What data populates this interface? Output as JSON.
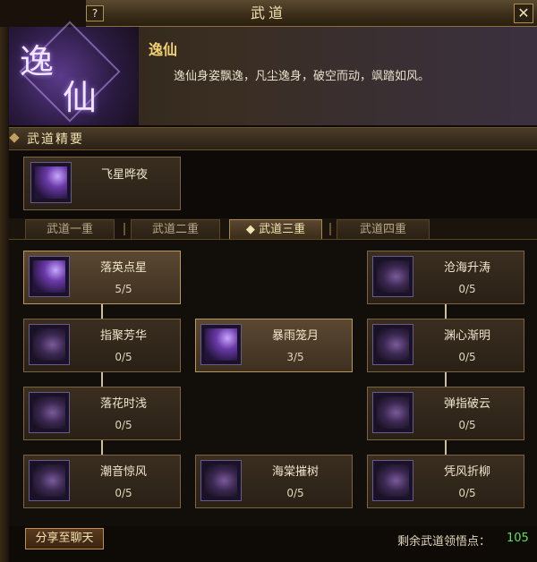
{
  "window": {
    "title": "武道",
    "help_label": "?",
    "close_label": "✕"
  },
  "header": {
    "emblem_char1": "逸",
    "emblem_char2": "仙",
    "class_name": "逸仙",
    "class_desc": "逸仙身姿飘逸，凡尘逸身，破空而动，飒踏如风。"
  },
  "section": {
    "title": "武道精要"
  },
  "feature": {
    "name": "飞星晔夜",
    "icon": "shooting-star-skill-icon"
  },
  "tabs": [
    {
      "label": "武道一重",
      "selected": false
    },
    {
      "label": "武道二重",
      "selected": false
    },
    {
      "label": "武道三重",
      "selected": true
    },
    {
      "label": "武道四重",
      "selected": false
    }
  ],
  "skills": {
    "r1c1": {
      "name": "落英点星",
      "level": "5/5"
    },
    "r1c3": {
      "name": "沧海升涛",
      "level": "0/5"
    },
    "r2c1": {
      "name": "指聚芳华",
      "level": "0/5"
    },
    "r2c2": {
      "name": "暴雨笼月",
      "level": "3/5"
    },
    "r2c3": {
      "name": "渊心渐明",
      "level": "0/5"
    },
    "r3c1": {
      "name": "落花时浅",
      "level": "0/5"
    },
    "r3c3": {
      "name": "弹指破云",
      "level": "0/5"
    },
    "r4c1": {
      "name": "潮音惊风",
      "level": "0/5"
    },
    "r4c2": {
      "name": "海棠摧树",
      "level": "0/5"
    },
    "r4c3": {
      "name": "凭风折柳",
      "level": "0/5"
    }
  },
  "footer": {
    "share_label": "分享至聊天",
    "points_label": "剩余武道领悟点：",
    "points_value": "105"
  },
  "colors": {
    "accent": "#f0d070",
    "points": "#60e060",
    "border": "#b89860"
  }
}
